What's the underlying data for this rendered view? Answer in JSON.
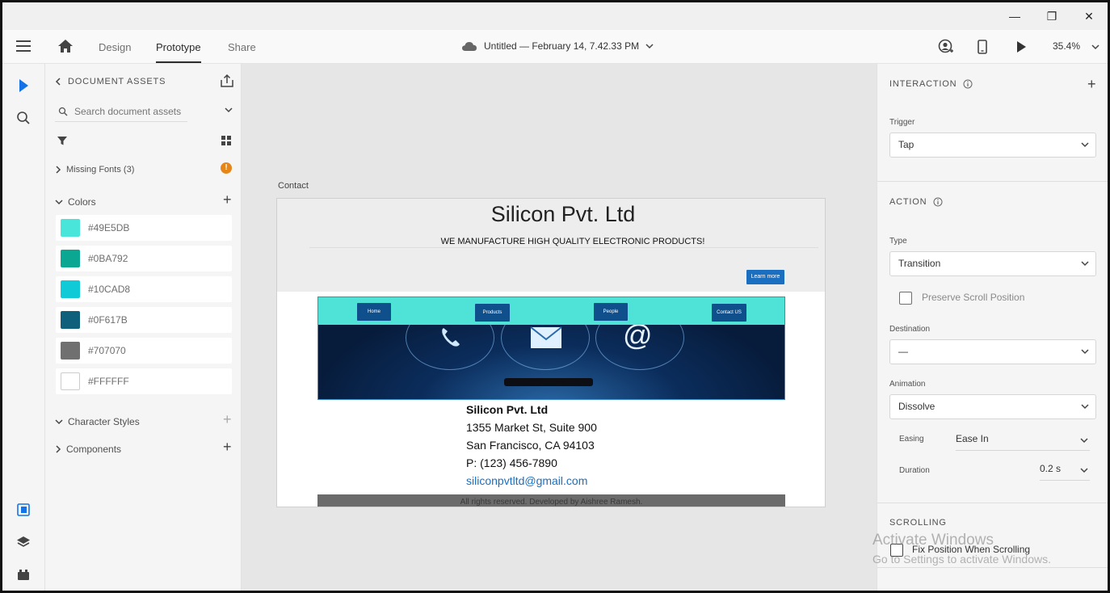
{
  "window": {
    "minimize": "—",
    "restore": "❐",
    "close": "✕"
  },
  "appbar": {
    "tabs": [
      "Design",
      "Prototype",
      "Share"
    ],
    "active_tab": "Prototype",
    "doc_title": "Untitled — February 14, 7.42.33 PM",
    "zoom": "35.4%"
  },
  "assets": {
    "header": "DOCUMENT ASSETS",
    "search_placeholder": "Search document assets",
    "missing_fonts": "Missing Fonts (3)",
    "colors_label": "Colors",
    "colors": [
      {
        "hex": "#49E5DB",
        "value": "#49E5DB"
      },
      {
        "hex": "#0BA792",
        "value": "#0BA792"
      },
      {
        "hex": "#10CAD8",
        "value": "#10CAD8"
      },
      {
        "hex": "#0F617B",
        "value": "#0F617B"
      },
      {
        "hex": "#707070",
        "value": "#707070"
      },
      {
        "hex": "#FFFFFF",
        "value": "#FFFFFF"
      }
    ],
    "character_styles": "Character Styles",
    "components": "Components"
  },
  "artboard": {
    "label": "Contact",
    "title": "Silicon Pvt. Ltd",
    "subtitle": "WE MANUFACTURE HIGH QUALITY ELECTRONIC PRODUCTS!",
    "learn_more": "Learn more",
    "nav": [
      "Home",
      "Products",
      "People",
      "Contact US"
    ],
    "contact_name": "Silicon Pvt. Ltd",
    "address1": "1355 Market St, Suite 900",
    "address2": "San Francisco, CA 94103",
    "phone": "P: (123) 456-7890",
    "email": "siliconpvtltd@gmail.com",
    "footer": "All rights reserved. Developed by Aishree Ramesh."
  },
  "interaction": {
    "header": "INTERACTION",
    "trigger_label": "Trigger",
    "trigger": "Tap",
    "action_header": "ACTION",
    "type_label": "Type",
    "type": "Transition",
    "preserve_scroll": "Preserve Scroll Position",
    "destination_label": "Destination",
    "destination": "—",
    "animation_label": "Animation",
    "animation": "Dissolve",
    "easing_label": "Easing",
    "easing": "Ease In",
    "duration_label": "Duration",
    "duration": "0.2 s",
    "scrolling_header": "SCROLLING",
    "fix_position": "Fix Position When Scrolling"
  },
  "watermark": {
    "line1": "Activate Windows",
    "line2": "Go to Settings to activate Windows."
  }
}
